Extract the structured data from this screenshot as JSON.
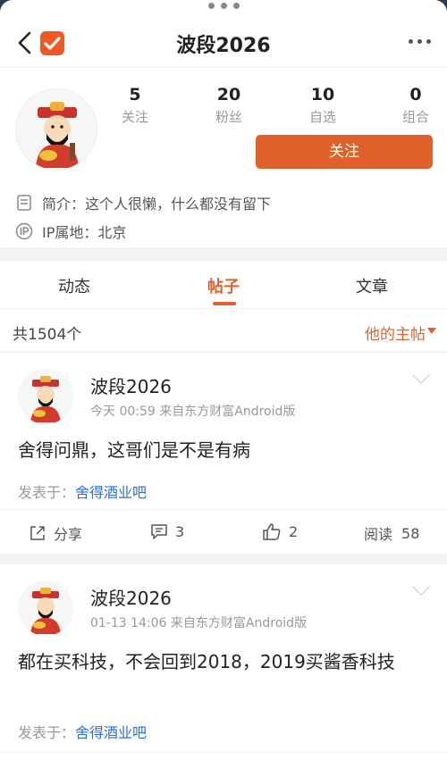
{
  "header": {
    "title": "波段2026"
  },
  "profile": {
    "stats": [
      {
        "num": "5",
        "label": "关注"
      },
      {
        "num": "20",
        "label": "粉丝"
      },
      {
        "num": "10",
        "label": "自选"
      },
      {
        "num": "0",
        "label": "组合"
      }
    ],
    "follow_label": "关注",
    "bio": "简介：这个人很懒，什么都没有留下",
    "ip": "IP属地：北京"
  },
  "tabs": [
    {
      "label": "动态"
    },
    {
      "label": "帖子"
    },
    {
      "label": "文章"
    }
  ],
  "list": {
    "count": "共1504个",
    "filter": "他的主帖"
  },
  "posts": [
    {
      "author": "波段2026",
      "meta": "今天 00:59  来自东方财富Android版",
      "content": "舍得问鼎，这哥们是不是有病",
      "posted_in_label": "发表于：",
      "forum": "舍得酒业吧",
      "share": "分享",
      "comments": "3",
      "likes": "2",
      "reads_label": "阅读",
      "reads": "58"
    },
    {
      "author": "波段2026",
      "meta": "01-13 14:06  来自东方财富Android版",
      "content": "都在买科技，不会回到2018，2019买酱香科技",
      "posted_in_label": "发表于：",
      "forum": "舍得酒业吧"
    }
  ],
  "colors": {
    "accent": "#e0622a",
    "link": "#2b6fd4"
  }
}
